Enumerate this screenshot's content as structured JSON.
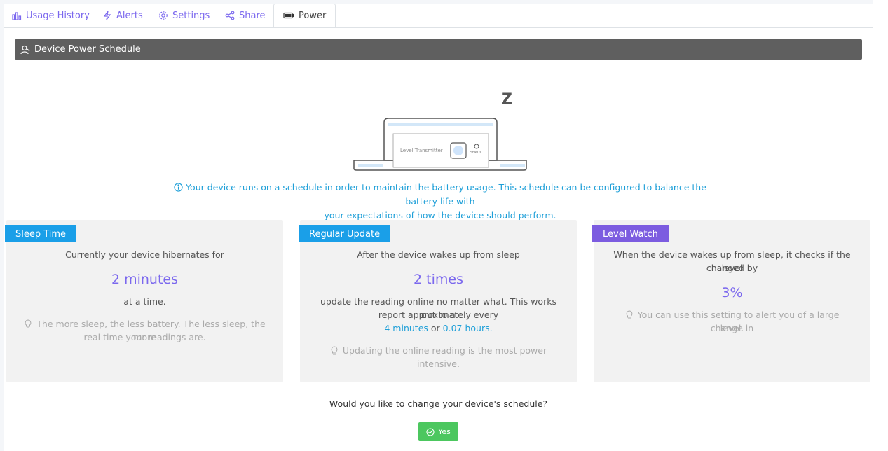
{
  "tabs": [
    {
      "label": "Usage History",
      "icon": "bar-chart-icon"
    },
    {
      "label": "Alerts",
      "icon": "lightning-icon"
    },
    {
      "label": "Settings",
      "icon": "gear-icon"
    },
    {
      "label": "Share",
      "icon": "share-icon"
    },
    {
      "label": "Power",
      "icon": "battery-icon",
      "active": true
    }
  ],
  "section": {
    "title": "Device Power Schedule",
    "icon": "user-icon"
  },
  "illustration": {
    "zzz": "Z",
    "device_label": "Level Transmitter",
    "status_label": "Status"
  },
  "info": {
    "line1": "Your device runs on a schedule in order to maintain the battery usage. This schedule can be configured to balance the battery life with",
    "line2": "your expectations of how the device should perform."
  },
  "cards": {
    "sleep": {
      "label": "Sleep Time",
      "intro": "Currently your device hibernates for",
      "value": "2 minutes",
      "after": "at a time.",
      "hint1": "The more sleep, the less battery. The less sleep, the more",
      "hint2": "real time your readings are."
    },
    "update": {
      "label": "Regular Update",
      "intro": "After the device wakes up from sleep",
      "value": "2 times",
      "desc1": "update the reading online no matter what. This works out to a",
      "desc2": "report approximately every",
      "minutes": "4 minutes",
      "or": "or",
      "hours": "0.07 hours.",
      "hint": "Updating the online reading is the most power intensive."
    },
    "level": {
      "label": "Level Watch",
      "intro1": "When the device wakes up from sleep, it checks if the level",
      "intro2": "changed by",
      "value": "3%",
      "hint1": "You can use this setting to alert you of a large change in",
      "hint2": "level."
    }
  },
  "question": "Would you like to change your device's schedule?",
  "yes_button": "Yes"
}
